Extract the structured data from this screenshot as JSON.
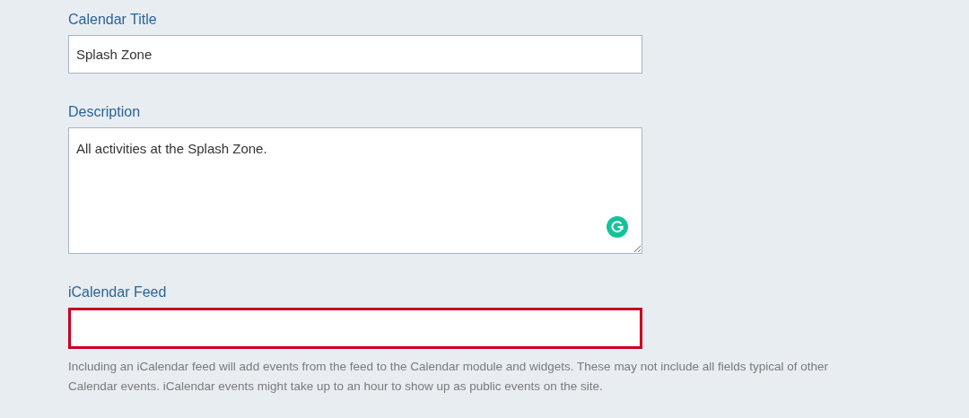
{
  "fields": [
    {
      "kind": "input",
      "label": "Calendar Title",
      "value": "Splash Zone",
      "invalid": false
    },
    {
      "kind": "textarea",
      "label": "Description",
      "value": "All activities at the Splash Zone.",
      "invalid": false,
      "grammar_assistant": true
    },
    {
      "kind": "input",
      "label": "iCalendar Feed",
      "invalid": true,
      "help": "Including an iCalendar feed will add events from the feed to the Calendar module and widgets. These may not include all fields typical of other Calendar events. iCalendar events might take up to an hour to show up as public events on the site."
    }
  ]
}
